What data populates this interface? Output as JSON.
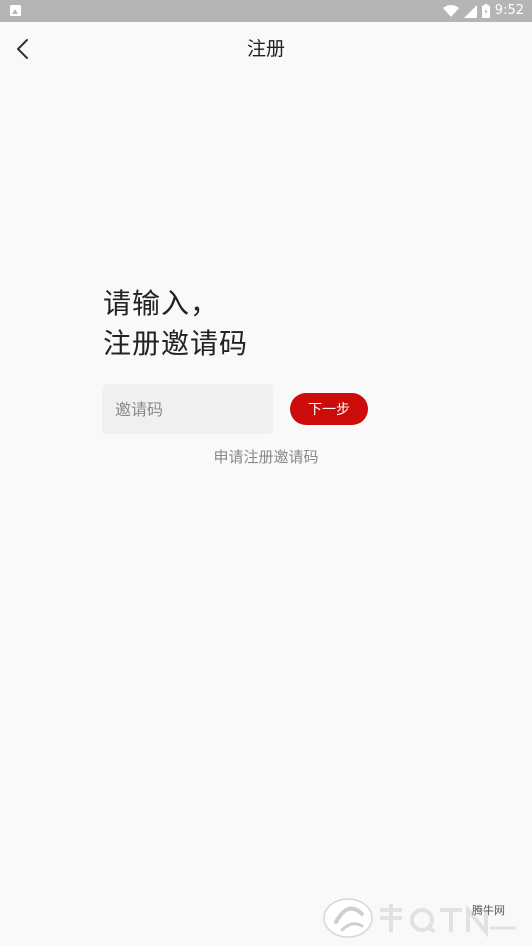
{
  "status_bar": {
    "time": "9:52"
  },
  "header": {
    "title": "注册"
  },
  "prompt": {
    "line1": "请输入，",
    "line2": "注册邀请码"
  },
  "invite_input": {
    "value": "",
    "placeholder": "邀请码"
  },
  "next_button": {
    "label": "下一步"
  },
  "apply_link": {
    "label": "申请注册邀请码"
  },
  "watermark": {
    "label": "腾牛网"
  },
  "colors": {
    "accent": "#cc0b0b",
    "background": "#f9f9f9",
    "status_bar": "#b5b5b5"
  }
}
